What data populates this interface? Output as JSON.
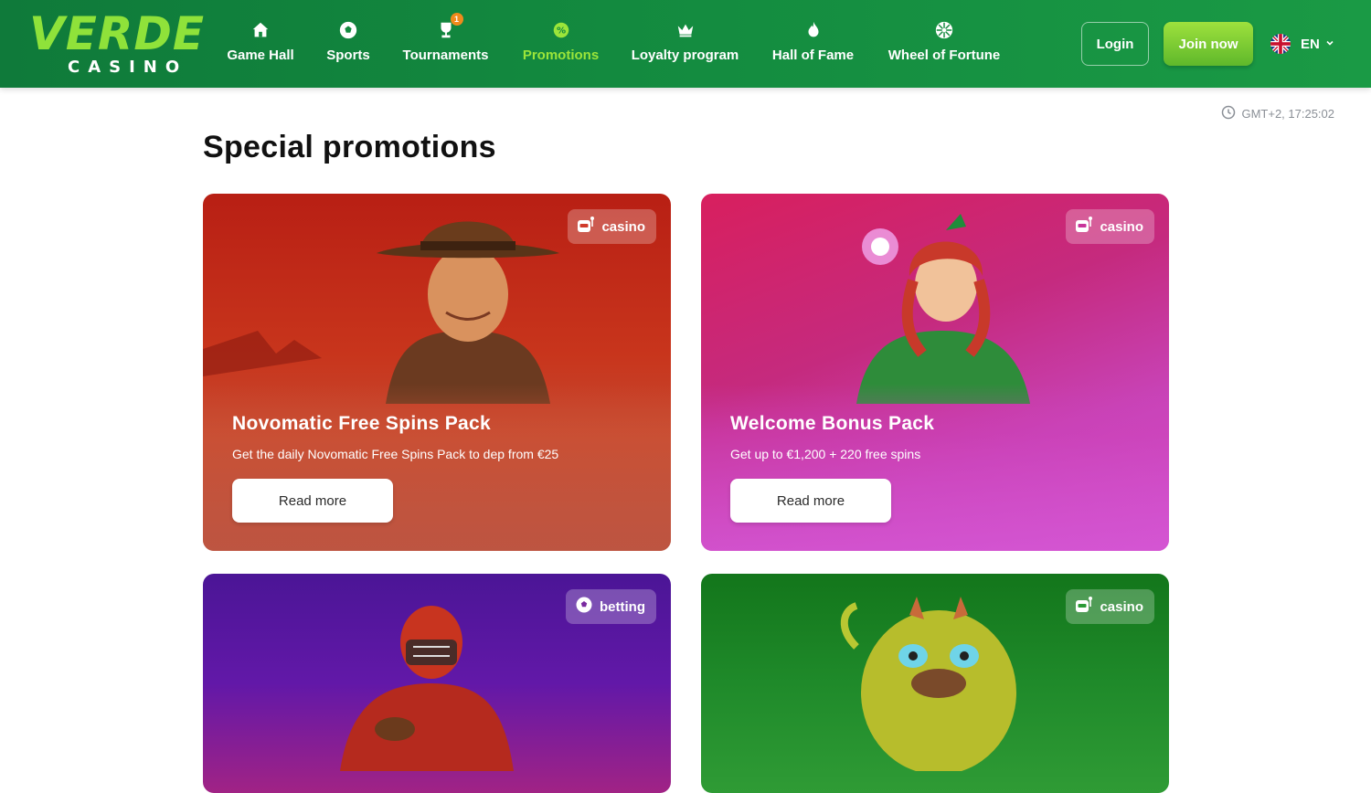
{
  "header": {
    "logo": {
      "word": "VERDE",
      "sub": "CASINO"
    },
    "nav": [
      {
        "label": "Game Hall",
        "icon": "house-icon",
        "active": false
      },
      {
        "label": "Sports",
        "icon": "soccer-ball-icon",
        "active": false
      },
      {
        "label": "Tournaments",
        "icon": "trophy-icon",
        "active": false,
        "badge": "1"
      },
      {
        "label": "Promotions",
        "icon": "percent-badge-icon",
        "active": true
      },
      {
        "label": "Loyalty program",
        "icon": "crown-icon",
        "active": false
      },
      {
        "label": "Hall of Fame",
        "icon": "flame-icon",
        "active": false
      },
      {
        "label": "Wheel of Fortune",
        "icon": "wheel-icon",
        "active": false
      }
    ],
    "login_label": "Login",
    "join_label": "Join now",
    "language": "EN"
  },
  "time": "GMT+2, 17:25:02",
  "page_title": "Special promotions",
  "cards": [
    {
      "tag": "casino",
      "title": "Novomatic Free Spins Pack",
      "description": "Get the daily Novomatic Free Spins Pack to dep from €25",
      "button": "Read more"
    },
    {
      "tag": "casino",
      "title": "Welcome Bonus Pack",
      "description": "Get up to €1,200 + 220 free spins",
      "button": "Read more"
    },
    {
      "tag": "betting",
      "title": "",
      "description": "",
      "button": ""
    },
    {
      "tag": "casino",
      "title": "",
      "description": "",
      "button": ""
    }
  ],
  "colors": {
    "header_green": "#138a3f",
    "accent_lime": "#9be53a",
    "join_button": "#7cc832"
  }
}
